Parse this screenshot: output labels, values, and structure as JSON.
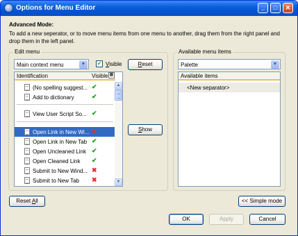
{
  "window": {
    "title": "Options for Menu Editor",
    "controls": {
      "minimize": "_",
      "maximize": "□",
      "close": "✕"
    }
  },
  "intro": {
    "heading": "Advanced Mode:",
    "text_line1": "To add a new seperator, or to move menu items from one menu to another, drag them from the right panel and",
    "text_line2": "drop them in the left panel."
  },
  "edit_menu": {
    "group_label": "Edit menu",
    "menu_select": "Main context menu",
    "visible_label": "Visible",
    "visible_checked": true,
    "reset_label": "Reset",
    "show_label": "Show",
    "columns": {
      "identification": "Identification",
      "visible": "Visible"
    },
    "items": [
      {
        "label": "(No spelling suggest...",
        "visible": true,
        "selected": false
      },
      {
        "label": "Add to dictionary",
        "visible": true,
        "selected": false
      },
      {
        "label": "View User Script So...",
        "visible": true,
        "selected": false
      },
      {
        "label": "Open Link in New Wi...",
        "visible": false,
        "selected": true
      },
      {
        "label": "Open Link in New Tab",
        "visible": true,
        "selected": false
      },
      {
        "label": "Open Uncleaned Link",
        "visible": true,
        "selected": false
      },
      {
        "label": "Open Cleaned Link",
        "visible": true,
        "selected": false
      },
      {
        "label": "Submit to New Wind...",
        "visible": false,
        "selected": false
      },
      {
        "label": "Submit to New Tab",
        "visible": false,
        "selected": false
      }
    ]
  },
  "available": {
    "group_label": "Available menu items",
    "palette_select": "Palette",
    "column": "Available items",
    "items": [
      "<New separator>"
    ]
  },
  "buttons": {
    "reset_all": "Reset All",
    "simple_mode": "<< Simple mode",
    "ok": "OK",
    "apply": "Apply",
    "cancel": "Cancel"
  },
  "glyphs": {
    "check": "✔",
    "cross": "✖",
    "dropdown": "▼",
    "scroll_up": "▲",
    "scroll_down": "▼",
    "scroll_grip": "≡"
  },
  "colors": {
    "titlebar": "#0453d2",
    "selection": "#316ac5",
    "visible_yes": "#1c9c1c",
    "visible_no": "#e03030",
    "header_underline": "#e8c15e"
  }
}
